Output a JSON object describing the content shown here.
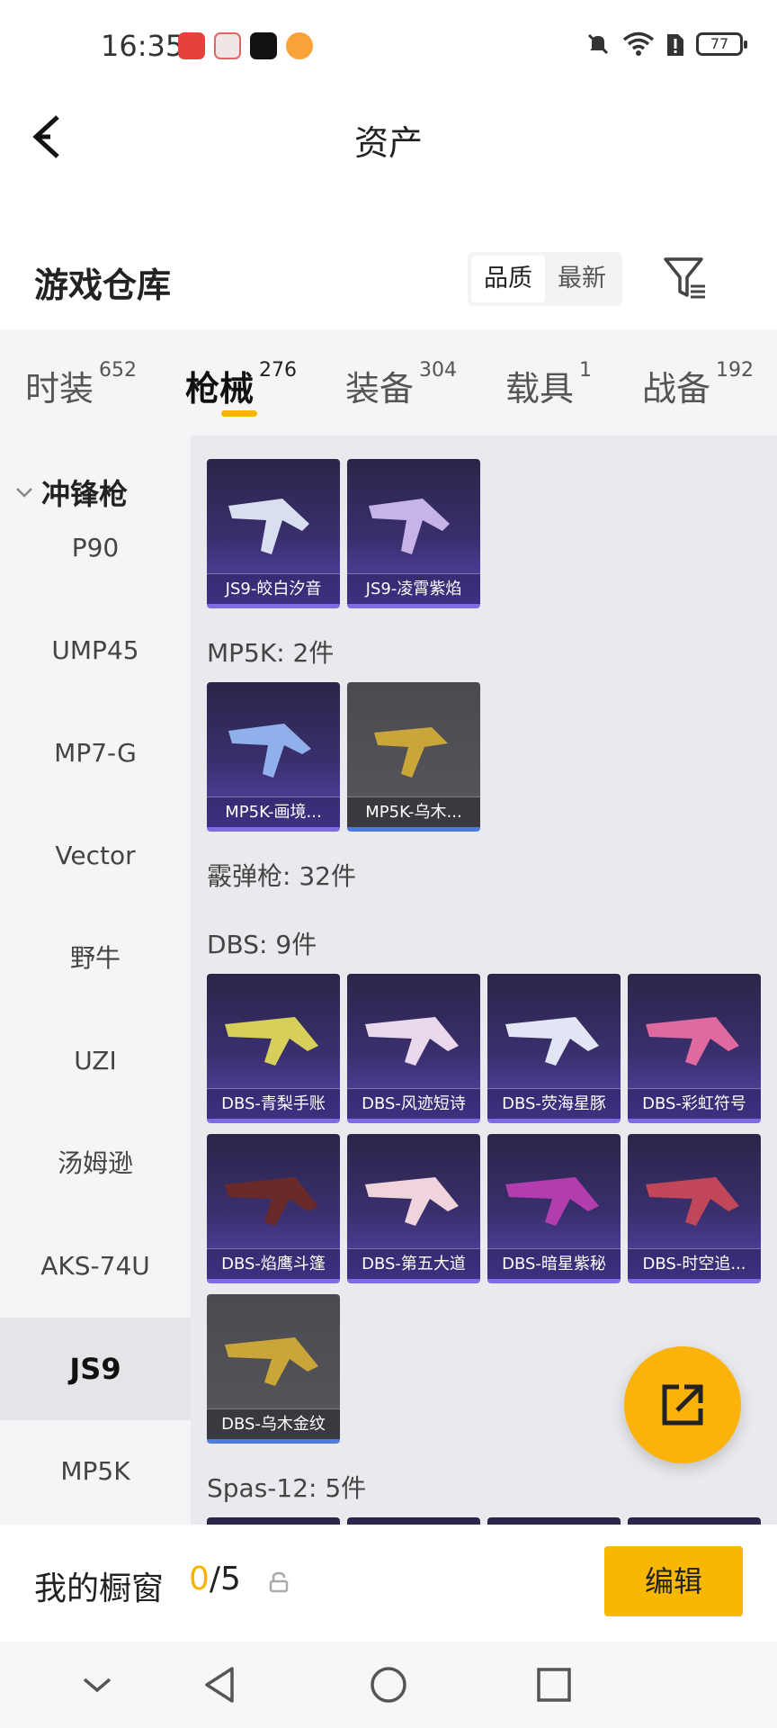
{
  "status_bar": {
    "time": "16:35",
    "battery": "77"
  },
  "header": {
    "title": "资产"
  },
  "warehouse": {
    "title": "游戏仓库",
    "sort": [
      "品质",
      "最新"
    ]
  },
  "tabs": [
    {
      "label": "时装",
      "count": "652"
    },
    {
      "label": "枪械",
      "count": "276"
    },
    {
      "label": "装备",
      "count": "304"
    },
    {
      "label": "载具",
      "count": "1"
    },
    {
      "label": "战备",
      "count": "192"
    }
  ],
  "sidebar": {
    "head": "冲锋枪",
    "items": [
      "P90",
      "UMP45",
      "MP7-G",
      "Vector",
      "野牛",
      "UZI",
      "汤姆逊",
      "AKS-74U",
      "JS9",
      "MP5K"
    ]
  },
  "groups": {
    "js9_items": [
      "JS9-皎白汐音",
      "JS9-凌霄紫焰"
    ],
    "mp5k_label": "MP5K: 2件",
    "mp5k_items": [
      "MP5K-画境...",
      "MP5K-乌木..."
    ],
    "shotgun_label": "霰弹枪: 32件",
    "dbs_label": "DBS: 9件",
    "dbs_items": [
      "DBS-青梨手账",
      "DBS-风迹短诗",
      "DBS-荧海星豚",
      "DBS-彩虹符号",
      "DBS-焰鹰斗篷",
      "DBS-第五大道",
      "DBS-暗星紫秘",
      "DBS-时空追...",
      "DBS-乌木金纹"
    ],
    "spas_label": "Spas-12: 5件"
  },
  "bottom_bar": {
    "title": "我的橱窗",
    "current": "0",
    "total": "/5",
    "edit": "编辑"
  },
  "colors": {
    "accent": "#f8b700",
    "epic": "#7e6ce6",
    "common": "#4f7be0"
  }
}
